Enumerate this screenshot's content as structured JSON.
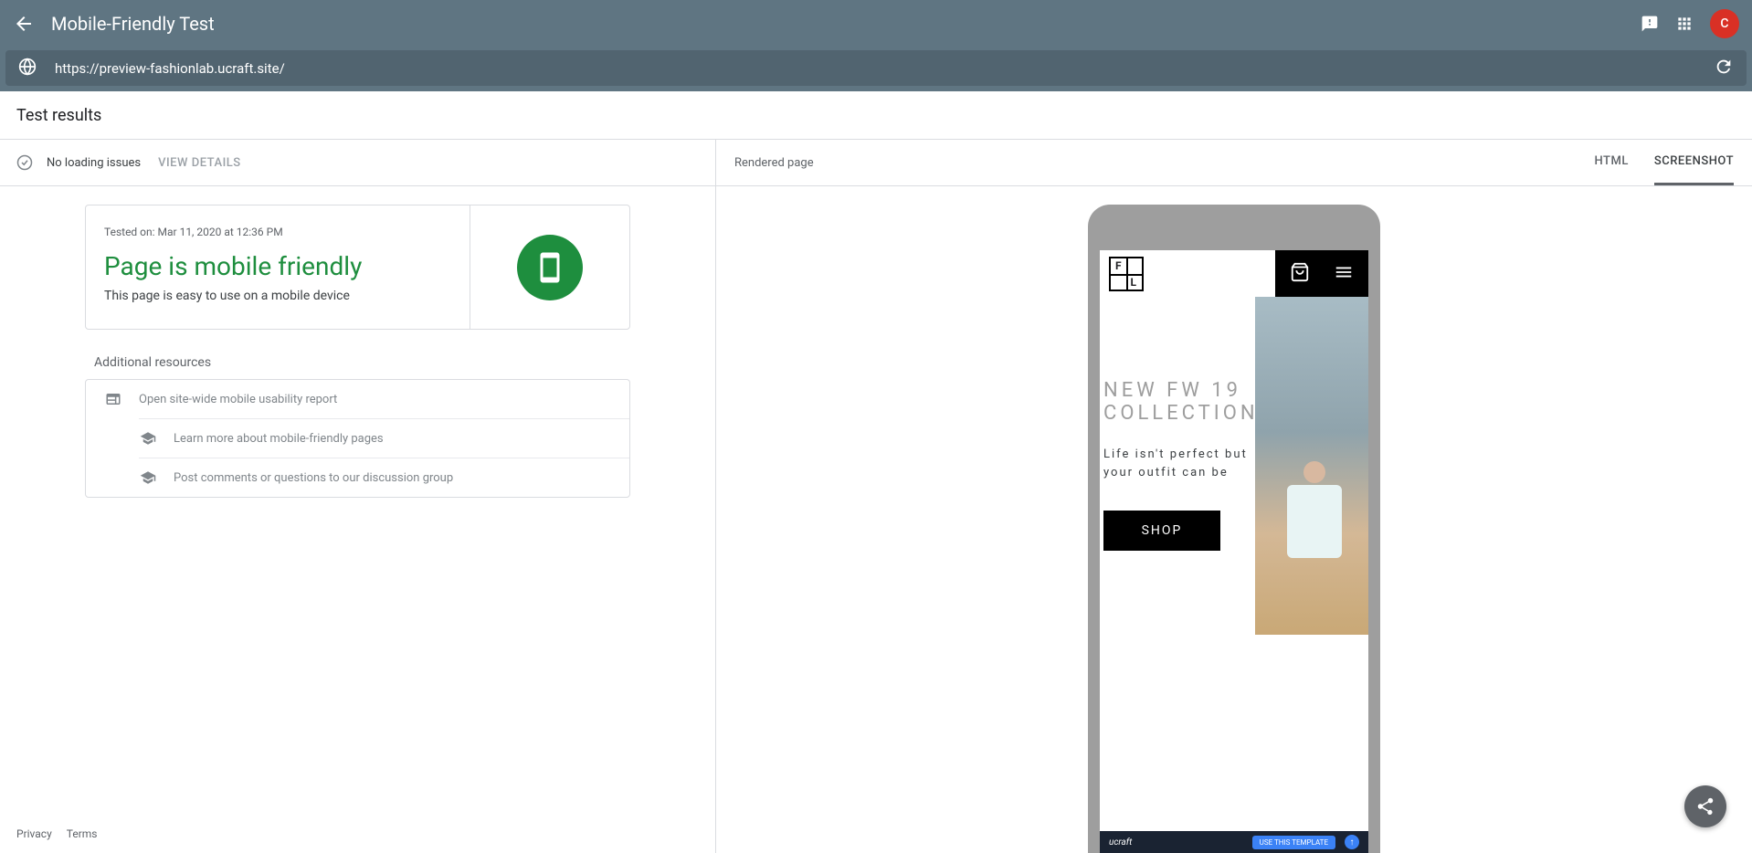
{
  "header": {
    "title": "Mobile-Friendly Test",
    "avatar_letter": "C"
  },
  "url_bar": {
    "url": "https://preview-fashionlab.ucraft.site/"
  },
  "results_header": "Test results",
  "loading": {
    "status": "No loading issues",
    "view_details": "VIEW DETAILS"
  },
  "result_card": {
    "tested_on": "Tested on: Mar 11, 2020 at 12:36 PM",
    "title": "Page is mobile friendly",
    "description": "This page is easy to use on a mobile device"
  },
  "additional": {
    "title": "Additional resources",
    "items": [
      "Open site-wide mobile usability report",
      "Learn more about mobile-friendly pages",
      "Post comments or questions to our discussion group"
    ]
  },
  "footer": {
    "privacy": "Privacy",
    "terms": "Terms"
  },
  "right": {
    "rendered": "Rendered page",
    "tab_html": "HTML",
    "tab_screenshot": "SCREENSHOT"
  },
  "preview": {
    "logo_f": "F",
    "logo_l": "L",
    "collection_line1": "NEW FW 19",
    "collection_line2": "COLLECTION",
    "tagline": "Life isn't perfect but your outfit can be",
    "shop": "SHOP",
    "ucraft": "ucraft",
    "template_btn": "USE THIS TEMPLATE",
    "up": "↑"
  }
}
